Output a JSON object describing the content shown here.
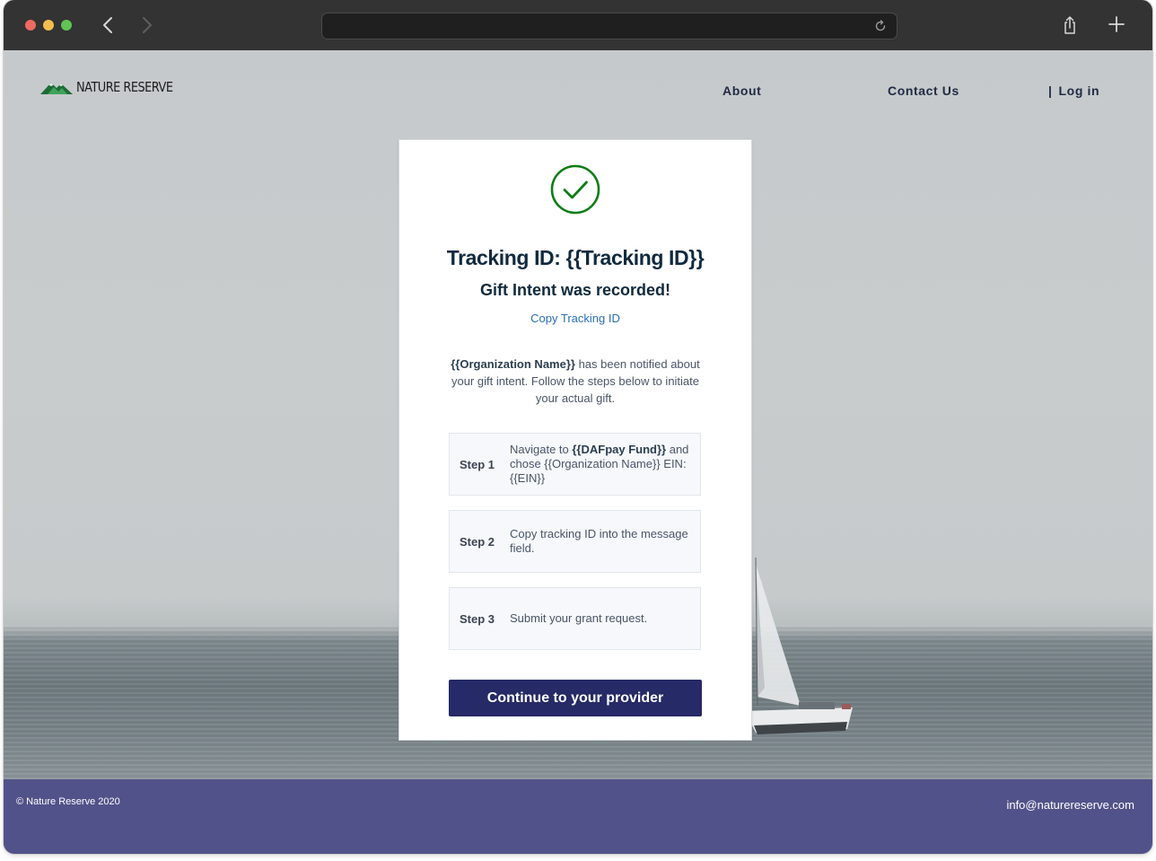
{
  "browser": {
    "url": "",
    "icons": {
      "back": "chevron-left-icon",
      "forward": "chevron-right-icon",
      "reload": "reload-icon",
      "share": "share-icon",
      "new_tab": "plus-icon"
    }
  },
  "header": {
    "brand": "NATURE RESERVE",
    "logo_icon": "mountain-logo-icon",
    "nav": {
      "about": "About",
      "contact": "Contact Us",
      "login_separator": "|",
      "login": "Log in"
    }
  },
  "card": {
    "status_icon": "check-circle-icon",
    "title": "Tracking ID: {{Tracking ID}}",
    "subtitle": "Gift Intent was recorded!",
    "copy_link": "Copy Tracking ID",
    "notice": {
      "org": "{{Organization Name}}",
      "text": " has been notified about your gift intent. Follow the steps below to initiate your actual gift."
    },
    "steps": [
      {
        "label": "Step 1",
        "pre": "Navigate to ",
        "bold": "{{DAFpay Fund}}",
        "post": " and chose {{Organization Name}} EIN: {{EIN}}"
      },
      {
        "label": "Step 2",
        "text": "Copy tracking ID into the message field."
      },
      {
        "label": "Step 3",
        "text": "Submit your grant request."
      }
    ],
    "continue_button": "Continue to your provider"
  },
  "footer": {
    "copyright": "© Nature Reserve 2020",
    "email": "info@naturereserve.com"
  },
  "colors": {
    "brand_primary": "#262a66",
    "footer_bg": "#52528a",
    "success_green": "#0f7d17",
    "link_blue": "#2a6fb5",
    "heading": "#102a3e"
  }
}
